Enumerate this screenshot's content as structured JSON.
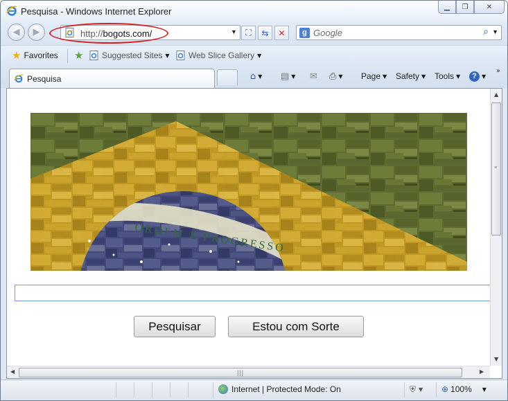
{
  "window": {
    "title": "Pesquisa - Windows Internet Explorer",
    "controls": {
      "minimize": "▁",
      "restore": "❐",
      "close": "✕"
    }
  },
  "address_bar": {
    "scheme": "http://",
    "host": "bogots.com/",
    "highlight_color": "#d42020"
  },
  "search": {
    "placeholder": "Google",
    "provider_letter": "g"
  },
  "favorites_bar": {
    "favorites_label": "Favorites",
    "items": [
      "Suggested Sites",
      "Web Slice Gallery"
    ]
  },
  "tabs": [
    {
      "label": "Pesquisa",
      "active": true
    }
  ],
  "command_bar": {
    "page": "Page",
    "safety": "Safety",
    "tools": "Tools"
  },
  "page": {
    "banner": "ORDEM E PROGRESSO",
    "query_value": "",
    "buttons": [
      "Pesquisar",
      "Estou com Sorte"
    ]
  },
  "status_bar": {
    "zone": "Internet | Protected Mode: On",
    "zoom": "100%"
  },
  "icons": {
    "back": "back-arrow-icon",
    "forward": "forward-arrow-icon",
    "refresh": "refresh-icon",
    "stop": "stop-icon",
    "home": "home-icon",
    "feeds": "rss-feed-icon",
    "mail": "mail-icon",
    "print": "printer-icon",
    "help": "help-icon"
  }
}
